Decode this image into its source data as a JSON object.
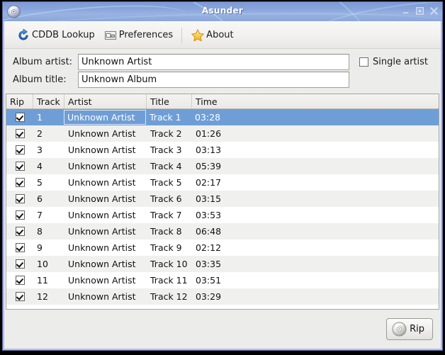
{
  "window": {
    "title": "Asunder",
    "icon": "cd-disc-icon",
    "buttons": [
      {
        "name": "minimize-button",
        "glyph": "minimize-icon",
        "label": "Minimize"
      },
      {
        "name": "maximize-button",
        "glyph": "maximize-icon",
        "label": "Maximize"
      },
      {
        "name": "close-button",
        "glyph": "close-icon",
        "label": "Close"
      }
    ]
  },
  "toolbar": {
    "items": [
      {
        "name": "cddb-lookup-button",
        "label": "CDDB Lookup",
        "icon": "refresh-circle-icon"
      },
      {
        "name": "preferences-button",
        "label": "Preferences",
        "icon": "preferences-window-icon"
      },
      {
        "name": "about-button",
        "label": "About",
        "icon": "star-icon"
      }
    ]
  },
  "fields": {
    "album_artist_label": "Album artist:",
    "album_artist_value": "Unknown Artist",
    "album_artist_placeholder": "Album artist",
    "album_title_label": "Album title:",
    "album_title_value": "Unknown Album",
    "album_title_placeholder": "Album title",
    "single_artist_label": "Single artist",
    "single_artist_checked": false
  },
  "track_list": {
    "columns": [
      "Rip",
      "Track",
      "Artist",
      "Title",
      "Time"
    ],
    "selected_index": 0,
    "rows": [
      {
        "rip": true,
        "track": "1",
        "artist": "Unknown Artist",
        "title": "Track 1",
        "time": "03:28"
      },
      {
        "rip": true,
        "track": "2",
        "artist": "Unknown Artist",
        "title": "Track 2",
        "time": "01:26"
      },
      {
        "rip": true,
        "track": "3",
        "artist": "Unknown Artist",
        "title": "Track 3",
        "time": "03:13"
      },
      {
        "rip": true,
        "track": "4",
        "artist": "Unknown Artist",
        "title": "Track 4",
        "time": "05:39"
      },
      {
        "rip": true,
        "track": "5",
        "artist": "Unknown Artist",
        "title": "Track 5",
        "time": "02:17"
      },
      {
        "rip": true,
        "track": "6",
        "artist": "Unknown Artist",
        "title": "Track 6",
        "time": "03:15"
      },
      {
        "rip": true,
        "track": "7",
        "artist": "Unknown Artist",
        "title": "Track 7",
        "time": "03:53"
      },
      {
        "rip": true,
        "track": "8",
        "artist": "Unknown Artist",
        "title": "Track 8",
        "time": "06:48"
      },
      {
        "rip": true,
        "track": "9",
        "artist": "Unknown Artist",
        "title": "Track 9",
        "time": "02:12"
      },
      {
        "rip": true,
        "track": "10",
        "artist": "Unknown Artist",
        "title": "Track 10",
        "time": "03:35"
      },
      {
        "rip": true,
        "track": "11",
        "artist": "Unknown Artist",
        "title": "Track 11",
        "time": "03:51"
      },
      {
        "rip": true,
        "track": "12",
        "artist": "Unknown Artist",
        "title": "Track 12",
        "time": "03:29"
      }
    ]
  },
  "footer": {
    "rip_label": "Rip",
    "rip_icon": "cd-disc-icon"
  },
  "colors": {
    "titlebar_blue": "#8aa5dc",
    "selection_blue": "#6f9ed6",
    "toolbar_grey": "#f2f1f0",
    "row_alt_grey": "#f0f0ef",
    "frame_border": "#5b6da8",
    "star_yellow": "#f4c842",
    "refresh_blue": "#2a6fc4"
  }
}
